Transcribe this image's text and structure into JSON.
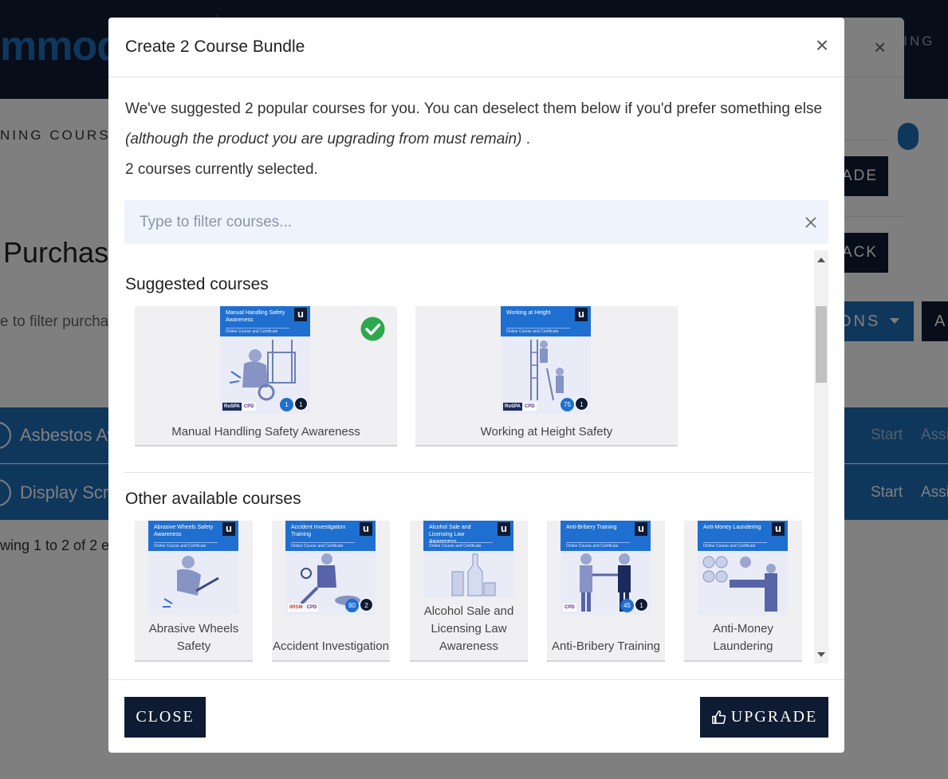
{
  "background": {
    "logo_text": "mmod",
    "header_right": "NING",
    "nav_text": "NING COURSE",
    "page_title": "Purchase",
    "filter_placeholder": "e to filter purcha",
    "options_button": "ONS",
    "dark_button": "A",
    "rows": [
      {
        "name": "Asbestos Aw",
        "start": "Start",
        "assign": "Assi"
      },
      {
        "name": "Display Scre",
        "start": "Start",
        "assign": "Assi"
      }
    ],
    "showing_text": "wing 1 to 2 of 2 e",
    "panel": {
      "close": "×",
      "button1": "ADE",
      "button2": "ACK"
    }
  },
  "modal": {
    "title": "Create 2 Course Bundle",
    "close_symbol": "×",
    "intro_text": "We've suggested 2 popular courses for you. You can deselect them below if you'd prefer something else",
    "intro_italic": "(although the product you are upgrading from must remain)",
    "intro_end": ".",
    "selected_count_text": "2 courses currently selected.",
    "filter_placeholder": "Type to filter courses...",
    "suggested_title": "Suggested courses",
    "other_title": "Other available courses",
    "suggested_courses": [
      {
        "label": "Manual Handling Safety Awareness",
        "thumb_title": "Manual Handling Safety Awareness",
        "thumb_sub": "Online Course and Certificate",
        "badge1": "1",
        "badge2": "1",
        "selected": true
      },
      {
        "label": "Working at Height Safety",
        "thumb_title": "Working at Height",
        "thumb_sub": "Online Course and Certificate",
        "badge1": "75",
        "badge2": "1",
        "selected": false
      }
    ],
    "other_courses": [
      {
        "label": "Abrasive Wheels Safety",
        "thumb_title": "Abrasive Wheels Safety Awareness",
        "thumb_sub": "Online Course and Certificate",
        "badge1": "",
        "badge2": ""
      },
      {
        "label": "Accident Investigation",
        "thumb_title": "Accident Investigation Training",
        "thumb_sub": "Online Course and Certificate",
        "badge1": "90",
        "badge2": "2"
      },
      {
        "label": "Alcohol Sale and Licensing Law Awareness",
        "thumb_title": "Alcohol Sale and Licensing Law Awareness",
        "thumb_sub": "Online Course and Certificate",
        "badge1": "",
        "badge2": ""
      },
      {
        "label": "Anti-Bribery Training",
        "thumb_title": "Anti-Bribery Training",
        "thumb_sub": "Online Course and Certificate",
        "badge1": "45",
        "badge2": "1"
      },
      {
        "label": "Anti-Money Laundering",
        "thumb_title": "Anti-Money Laundering",
        "thumb_sub": "Online Course and Certificate",
        "badge1": "",
        "badge2": ""
      }
    ],
    "accreditations": {
      "rospa": "RoSPA",
      "cpd": "CPD",
      "iirsm": "IIRSM"
    },
    "thumb_logo": "u",
    "close_button": "CLOSE",
    "upgrade_button": "UPGRADE"
  },
  "colors": {
    "navy": "#0e1b33",
    "brand_blue": "#1f6fb8",
    "check_green": "#2ea84f",
    "filter_bg": "#eef3fc"
  }
}
